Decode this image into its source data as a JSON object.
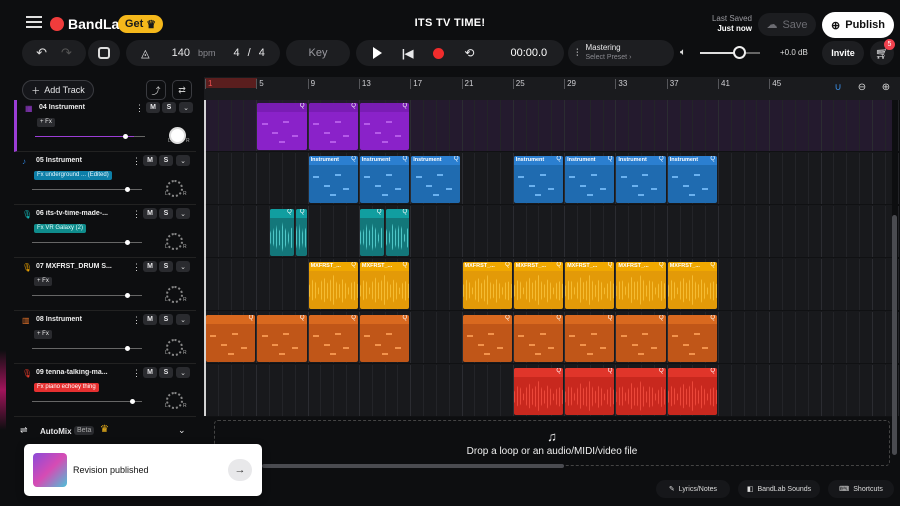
{
  "header": {
    "logo": "BandLab",
    "get_label": "Get",
    "project_title": "ITS TV TIME!",
    "last_saved_label": "Last Saved",
    "last_saved_value": "Just now",
    "save_label": "Save",
    "publish_label": "Publish"
  },
  "transport": {
    "tempo": "140",
    "tempo_unit": "bpm",
    "time_sig_num": "4",
    "time_sig_sep": "/",
    "time_sig_den": "4",
    "key_label": "Key",
    "time": "00:00.0",
    "mastering_label": "Mastering",
    "mastering_preset": "Select Preset",
    "volume_db": "+0.0 dB",
    "volume_level": 0.65,
    "invite_label": "Invite",
    "cart_badge": "5"
  },
  "toolbar": {
    "add_track_label": "Add Track"
  },
  "ruler": {
    "bars": [
      "1",
      "5",
      "9",
      "13",
      "17",
      "21",
      "25",
      "29",
      "33",
      "37",
      "41",
      "45"
    ]
  },
  "tracks": [
    {
      "number": "04",
      "name": "Instrument",
      "fx": "+ Fx",
      "fx_style": "plain",
      "icon": "keyboard-icon",
      "color": "#9b3dd6",
      "volume": 0.9,
      "selected": true
    },
    {
      "number": "05",
      "name": "Instrument",
      "fx": "Fx underground ... (Edited)",
      "fx_style": "blue",
      "icon": "synth-icon",
      "color": "#2c7fd6",
      "volume": 0.95
    },
    {
      "number": "06",
      "name": "its-tv-time-made-...",
      "fx": "Fx VR Galaxy (2)",
      "fx_style": "teal",
      "icon": "mic-icon",
      "color": "#12b8b8",
      "volume": 0.95
    },
    {
      "number": "07",
      "name": "MXFRST_DRUM S...",
      "fx": "+ Fx",
      "fx_style": "plain",
      "icon": "mic-icon",
      "color": "#f0a500",
      "volume": 0.95
    },
    {
      "number": "08",
      "name": "Instrument",
      "fx": "+ Fx",
      "fx_style": "plain",
      "icon": "piano-icon",
      "color": "#e8742a",
      "volume": 0.95
    },
    {
      "number": "09",
      "name": "tenna-talking-ma...",
      "fx": "Fx piano echoey thing",
      "fx_style": "red",
      "icon": "mic-icon",
      "color": "#e83a2a",
      "volume": 1.0
    }
  ],
  "track_controls": {
    "mute": "M",
    "solo": "S",
    "left": "L",
    "right": "R"
  },
  "automix": {
    "label": "AutoMix",
    "badge": "Beta"
  },
  "clips": {
    "instrument_label": "Instrument",
    "drum_label": "MXFRST_..."
  },
  "drop_area": {
    "text": "Drop a loop or an audio/MIDI/video file"
  },
  "toast": {
    "text": "Revision published"
  },
  "bottom": {
    "lyrics_label": "Lyrics/Notes",
    "sounds_label": "BandLab Sounds",
    "shortcuts_label": "Shortcuts"
  }
}
